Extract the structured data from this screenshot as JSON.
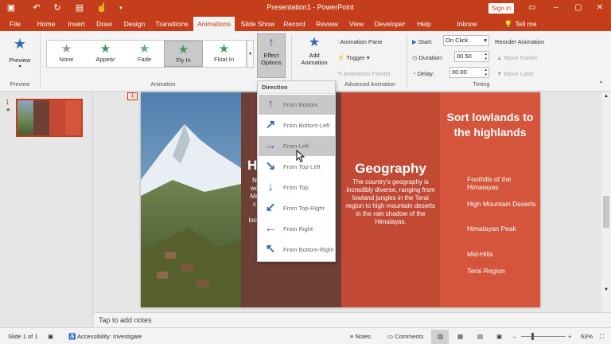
{
  "titlebar": {
    "title": "Presentation1  -  PowerPoint",
    "sign_in": "Sign in",
    "qa_icons": [
      "save-icon",
      "undo-icon",
      "redo-icon",
      "present-icon",
      "touch-icon",
      "customize-icon"
    ]
  },
  "tabs": [
    "File",
    "Home",
    "Insert",
    "Draw",
    "Design",
    "Transitions",
    "Animations",
    "Slide Show",
    "Record",
    "Review",
    "View",
    "Developer",
    "Help",
    "Inknoe ClassPoint",
    "Tell me"
  ],
  "active_tab": "Animations",
  "ribbon": {
    "preview": {
      "label": "Preview",
      "group": "Preview"
    },
    "gallery": [
      {
        "label": "None"
      },
      {
        "label": "Appear"
      },
      {
        "label": "Fade"
      },
      {
        "label": "Fly In"
      },
      {
        "label": "Float In"
      }
    ],
    "gallery_selected": "Fly In",
    "animation_group": "Animation",
    "effect_options": {
      "line1": "Effect",
      "line2": "Options"
    },
    "add_animation": {
      "line1": "Add",
      "line2": "Animation"
    },
    "animation_pane": "Animation Pane",
    "trigger": "Trigger",
    "animation_painter": "Animation Painter",
    "advanced_group": "Advanced Animation",
    "start_label": "Start:",
    "start_value": "On Click",
    "duration_label": "Duration:",
    "duration_value": "00.50",
    "delay_label": "Delay:",
    "delay_value": "00.00",
    "timing_group": "Timing",
    "reorder": "Reorder Animation",
    "move_earlier": "Move Earlier",
    "move_later": "Move Later"
  },
  "thumbnail": {
    "number": "1",
    "star": "★"
  },
  "slide": {
    "panel2_title": "H",
    "panel2_text": "N\nwo\nMo\nc\n\nloca",
    "panel3_title": "Geography",
    "panel3_text": "The country's geography is incredibly diverse, ranging from lowland jungles in the Terai region to high mountain deserts in the rain shadow of the Himalayas.",
    "panel4_title": "Sort lowlands to the highlands",
    "panel4_items": [
      "Foothills of the Himalayas",
      "High Mountain Deserts",
      "Himalayan Peak",
      "Mid-Hills",
      "Terai Region"
    ],
    "anim_tag": "1",
    "colors": {
      "orange": "#d4553b",
      "dark": "#6e4035",
      "mid": "#c24a35"
    }
  },
  "dropdown": {
    "header": "Direction",
    "items": [
      {
        "label": "From Bottom",
        "arrow": "↑",
        "icon": "arrow-up-icon"
      },
      {
        "label": "From Bottom-Left",
        "arrow": "↗",
        "icon": "arrow-up-right-icon"
      },
      {
        "label": "From Left",
        "arrow": "→",
        "icon": "arrow-right-icon"
      },
      {
        "label": "From Top-Left",
        "arrow": "↘",
        "icon": "arrow-down-right-icon"
      },
      {
        "label": "From Top",
        "arrow": "↓",
        "icon": "arrow-down-icon"
      },
      {
        "label": "From Top-Right",
        "arrow": "↙",
        "icon": "arrow-down-left-icon"
      },
      {
        "label": "From Right",
        "arrow": "←",
        "icon": "arrow-left-icon"
      },
      {
        "label": "From Bottom-Right",
        "arrow": "↖",
        "icon": "arrow-up-left-icon"
      }
    ],
    "highlighted": [
      "From Bottom",
      "From Left"
    ]
  },
  "notes_placeholder": "Tap to add notes",
  "status": {
    "slide": "Slide 1 of 1",
    "accessibility": "Accessibility: Investigate",
    "notes": "Notes",
    "comments": "Comments",
    "zoom": "63%"
  },
  "accent_color": "#c43e1c"
}
